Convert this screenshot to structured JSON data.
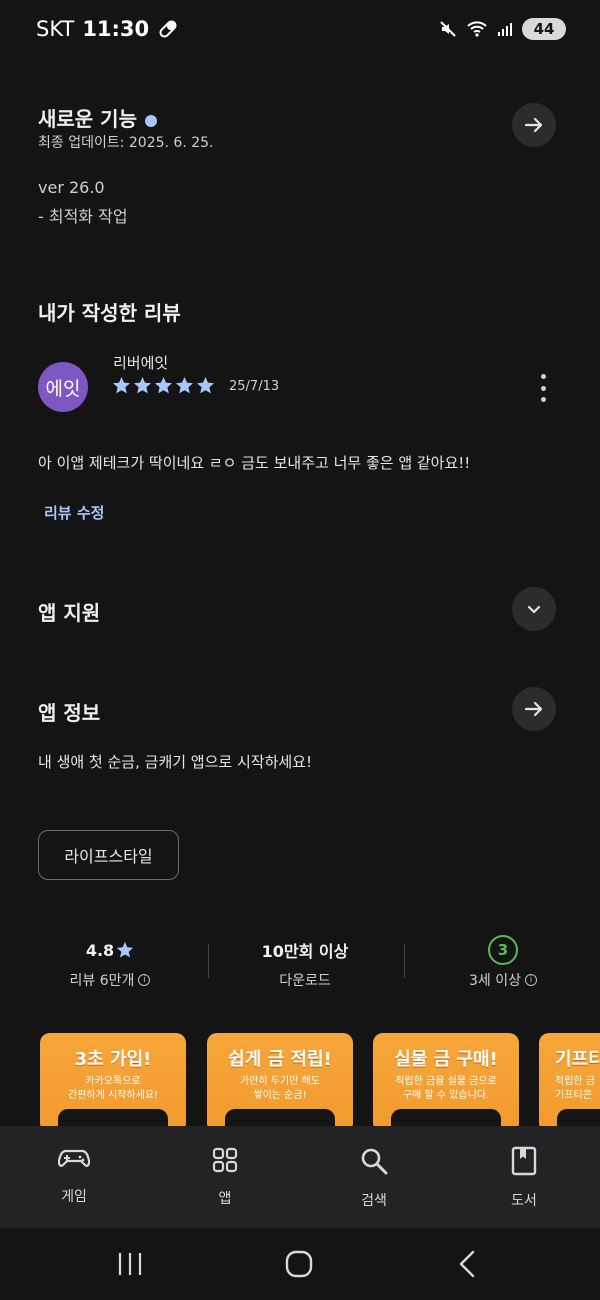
{
  "status": {
    "carrier": "SKT",
    "time": "11:30",
    "battery": "44"
  },
  "whats_new": {
    "title": "새로운 기능",
    "updated": "최종 업데이트: 2025. 6. 25.",
    "version": "ver 26.0",
    "note": "- 최적화 작업"
  },
  "my_review": {
    "section_title": "내가 작성한 리뷰",
    "avatar_text": "에잇",
    "reviewer": "리버에잇",
    "rating": 5,
    "date": "25/7/13",
    "text": "아 이앱 제테크가 딱이네요 ㄹㅇ 금도 보내주고 너무 좋은 앱 같아요!!",
    "edit_label": "리뷰 수정"
  },
  "app_support": {
    "title": "앱 지원"
  },
  "app_info": {
    "title": "앱 정보",
    "description": "내 생애 첫 순금, 금캐기 앱으로 시작하세요!",
    "category_chip": "라이프스타일"
  },
  "stats": {
    "rating_value": "4.8",
    "rating_label": "리뷰 6만개",
    "downloads_value": "10만회 이상",
    "downloads_label": "다운로드",
    "age_value": "3",
    "age_label": "3세 이상"
  },
  "screenshots": [
    {
      "title": "3초 가입!",
      "desc": "카카오톡으로\n간편하게 시작하세요!"
    },
    {
      "title": "쉽게 금 적립!",
      "desc": "가만히 두기만 해도\n쌓이는 순금!"
    },
    {
      "title": "실물 금 구매!",
      "desc": "적립한 금을 실물 금으로\n구매 할 수 있습니다."
    },
    {
      "title": "기프티",
      "desc": "적립한 금\n기프티콘"
    }
  ],
  "bottom_nav": [
    {
      "label": "게임",
      "icon": "gamepad-icon"
    },
    {
      "label": "앱",
      "icon": "apps-grid-icon"
    },
    {
      "label": "검색",
      "icon": "search-icon"
    },
    {
      "label": "도서",
      "icon": "book-icon"
    }
  ],
  "colors": {
    "background": "#141414",
    "accent_blue": "#a8c7fa",
    "avatar": "#7e57c2",
    "age_green": "#5cb85c",
    "screenshot_orange": "#f6a63a"
  }
}
